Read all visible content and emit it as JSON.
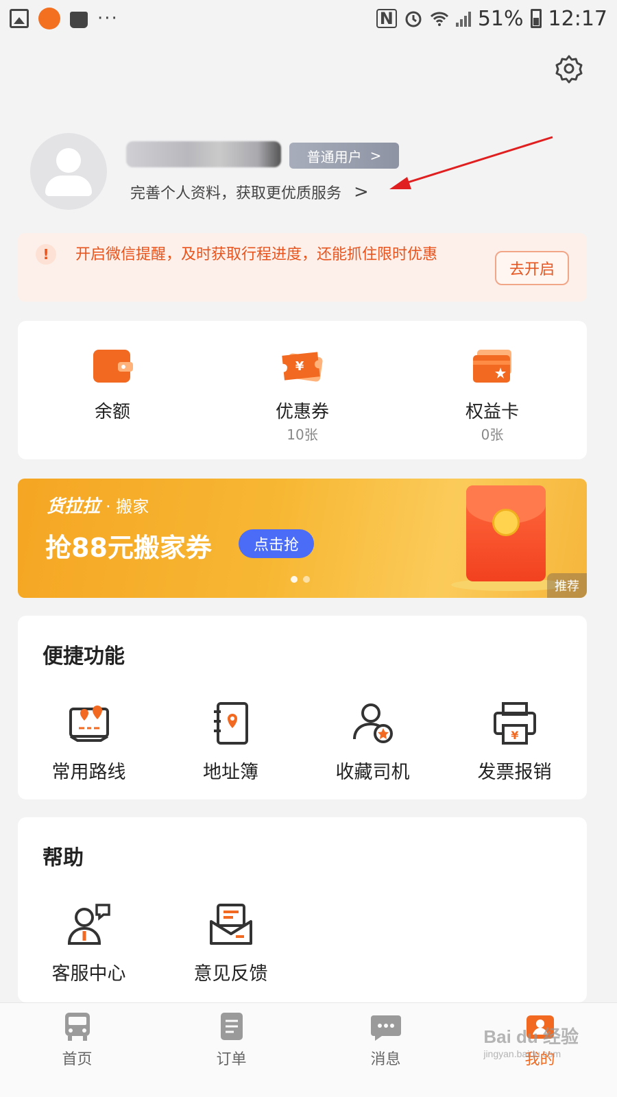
{
  "status_bar": {
    "battery": "51%",
    "time": "12:17",
    "nfc": "N",
    "more": "···"
  },
  "profile": {
    "badge_label": "普通用户",
    "badge_chevron": ">",
    "subtitle": "完善个人资料，获取更优质服务",
    "subtitle_chevron": ">"
  },
  "notice": {
    "icon_text": "!",
    "text": "开启微信提醒，及时获取行程进度，还能抓住限时优惠",
    "button": "去开启"
  },
  "wallet": [
    {
      "label": "余额",
      "sub": ""
    },
    {
      "label": "优惠券",
      "sub": "10张"
    },
    {
      "label": "权益卡",
      "sub": "0张"
    }
  ],
  "banner": {
    "brand": "货拉拉",
    "brand_sub": "· 搬家",
    "headline": "抢88元搬家券",
    "cta": "点击抢",
    "tag": "推荐",
    "slides": 2,
    "active_slide": 1
  },
  "shortcuts": {
    "title": "便捷功能",
    "items": [
      {
        "label": "常用路线",
        "icon": "route-map-icon"
      },
      {
        "label": "地址簿",
        "icon": "address-book-icon"
      },
      {
        "label": "收藏司机",
        "icon": "favorite-driver-icon"
      },
      {
        "label": "发票报销",
        "icon": "invoice-printer-icon"
      }
    ]
  },
  "help": {
    "title": "帮助",
    "items": [
      {
        "label": "客服中心",
        "icon": "customer-service-icon"
      },
      {
        "label": "意见反馈",
        "icon": "feedback-icon"
      }
    ]
  },
  "tabbar": {
    "items": [
      {
        "label": "首页",
        "icon": "truck-icon"
      },
      {
        "label": "订单",
        "icon": "order-list-icon"
      },
      {
        "label": "消息",
        "icon": "message-icon"
      },
      {
        "label": "我的",
        "icon": "profile-icon"
      }
    ],
    "active": 3
  },
  "watermark": {
    "text": "Bai du 经验",
    "sub": "jingyan.baidu.com"
  },
  "colors": {
    "accent": "#f26a21",
    "notice_text": "#e8541e",
    "notice_bg": "#fdf0ea",
    "cta_blue": "#4a6cf7",
    "annotation_red": "#e02020"
  }
}
